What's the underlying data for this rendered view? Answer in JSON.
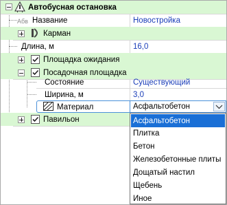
{
  "tree": {
    "root_label": "Автобусная остановка",
    "name_prefix": "Абв",
    "name_label": "Название",
    "name_value": "Новостройка",
    "pocket_label": "Карман",
    "length_label": "Длина, м",
    "length_value": "16,0",
    "waiting_label": "Площадка ожидания",
    "boarding_label": "Посадочная площадка",
    "state_label": "Состояние",
    "state_value": "Существующий",
    "width_label": "Ширина, м",
    "width_value": "3,0",
    "material_label": "Материал",
    "pavilion_label": "Павильон"
  },
  "combo": {
    "selected": "Асфальтобетон",
    "options": [
      "Асфальтобетон",
      "Плитка",
      "Бетон",
      "Железобетонные плиты",
      "Дощатый настил",
      "Щебень",
      "Иное"
    ]
  },
  "colors": {
    "group_row": "#d9f7d3",
    "value_text": "#1a3db8",
    "selection": "#1a6fd6"
  }
}
